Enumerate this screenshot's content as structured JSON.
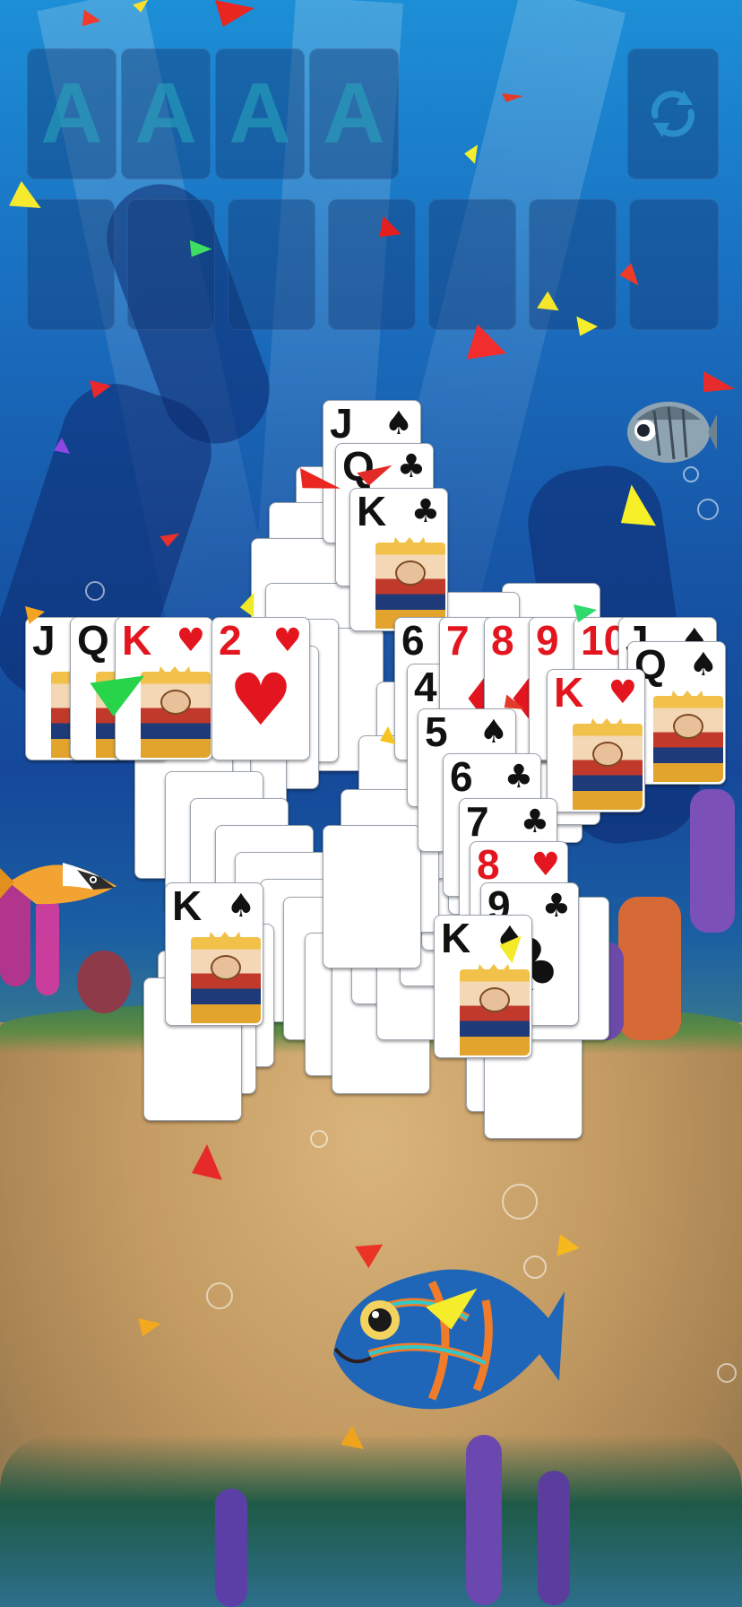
{
  "game": {
    "foundations": [
      "A",
      "A",
      "A",
      "A"
    ],
    "reset_icon": "refresh-icon"
  },
  "tableau": {
    "columns": [
      {
        "rank": "J",
        "suit": "♠",
        "color": "black"
      },
      {
        "rank": "Q",
        "suit": "♣",
        "color": "black"
      },
      {
        "rank": "K",
        "suit": "♣",
        "color": "black"
      },
      {
        "rank": "J",
        "suit": "♠",
        "color": "black"
      },
      {
        "rank": "Q",
        "suit": "♠",
        "color": "black"
      },
      {
        "rank": "K",
        "suit": "♥",
        "color": "red"
      },
      {
        "rank": "2",
        "suit": "♥",
        "color": "red"
      },
      {
        "rank": "6",
        "suit": "♠",
        "color": "black"
      },
      {
        "rank": "4",
        "suit": "♠",
        "color": "black"
      },
      {
        "rank": "7",
        "suit": "♦",
        "color": "red"
      },
      {
        "rank": "8",
        "suit": "♦",
        "color": "red"
      },
      {
        "rank": "9",
        "suit": "♦",
        "color": "red"
      },
      {
        "rank": "10",
        "suit": "♥",
        "color": "red"
      },
      {
        "rank": "J",
        "suit": "♠",
        "color": "black"
      },
      {
        "rank": "Q",
        "suit": "♠",
        "color": "black"
      },
      {
        "rank": "K",
        "suit": "♥",
        "color": "red"
      },
      {
        "rank": "5",
        "suit": "♠",
        "color": "black"
      },
      {
        "rank": "6",
        "suit": "♣",
        "color": "black"
      },
      {
        "rank": "7",
        "suit": "♣",
        "color": "black"
      },
      {
        "rank": "8",
        "suit": "♥",
        "color": "red"
      },
      {
        "rank": "9",
        "suit": "♣",
        "color": "black"
      },
      {
        "rank": "K",
        "suit": "♠",
        "color": "black"
      },
      {
        "rank": "K",
        "suit": "♠",
        "color": "black"
      }
    ]
  },
  "colors": {
    "water_top": "#1c8fd6",
    "water_deep": "#15489a",
    "sand": "#c9a470",
    "card_red": "#e3161f",
    "card_black": "#111111",
    "slot": "#143c78"
  },
  "decor": {
    "fish_icons": [
      "butterflyfish-icon",
      "clownfish-icon",
      "mandarinfish-icon"
    ],
    "effect": "confetti"
  }
}
